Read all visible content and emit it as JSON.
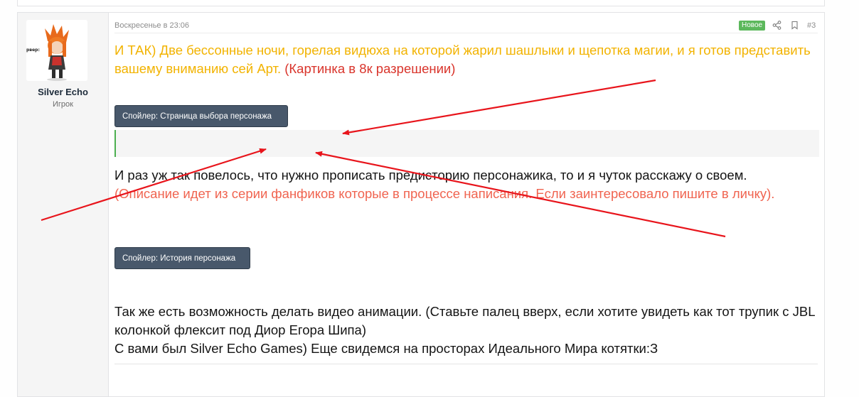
{
  "user": {
    "name": "Silver Echo",
    "title": "Игрок",
    "avatar_tag": "рвер:"
  },
  "post": {
    "date": "Воскресенье в 23:06",
    "badge": "Новое",
    "number": "#3",
    "intro_yellow": "И ТАК) Две бессонные ночи, горелая видюха на которой жарил шашлыки и щепотка магии, и я готов представить вашему вниманию сей Арт.",
    "intro_red": "(Картинка в 8к разрешении)",
    "spoiler1_label": "Спойлер: Страница выбора персонажа",
    "story_text": "И раз уж так повелось, что нужно прописать предисторию персонажика, то и я чуток расскажу о своем.",
    "story_note": "(Описание идет из серии фанфиков которые в процессе написания. Если заинтересовало пишите в личку).",
    "spoiler2_label": "Спойлер: История персонажа",
    "outro_line1": "Так же есть возможность делать видео анимации. (Ставьте палец вверх, если хотите увидеть как тот трупик с JBL колонкой флексит под Диор Егора Шипа)",
    "outro_line2": "С вами был Silver Echo Games) Еще свидемся на просторах Идеального Мира котятки:З"
  },
  "colors": {
    "highlight_yellow": "#f2b300",
    "highlight_red": "#d9342b",
    "note_salmon": "#f06450",
    "spoiler_button": "#48586b",
    "new_badge": "#5cb85c",
    "annotation_arrows": "#e8141b"
  },
  "icons": [
    "share-icon",
    "bookmark-icon"
  ]
}
